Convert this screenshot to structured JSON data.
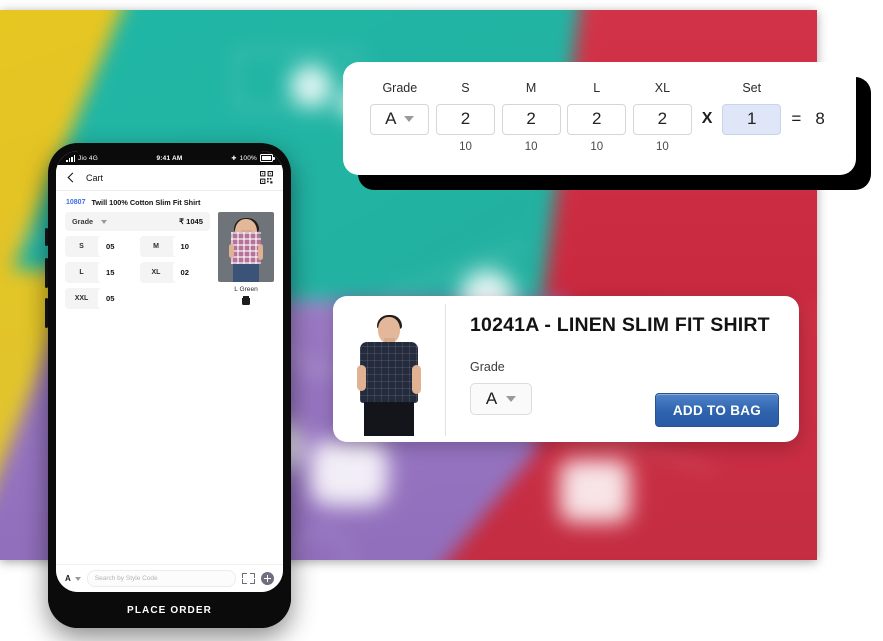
{
  "grade_card": {
    "columns": [
      {
        "label": "Grade",
        "value": "A",
        "sub": "",
        "type": "select"
      },
      {
        "label": "S",
        "value": "2",
        "sub": "10",
        "type": "number"
      },
      {
        "label": "M",
        "value": "2",
        "sub": "10",
        "type": "number"
      },
      {
        "label": "L",
        "value": "2",
        "sub": "10",
        "type": "number"
      },
      {
        "label": "XL",
        "value": "2",
        "sub": "10",
        "type": "number"
      }
    ],
    "multiply_symbol": "X",
    "set": {
      "label": "Set",
      "value": "1"
    },
    "equals_symbol": "=",
    "total": "8",
    "set_highlight_color": "#dee6f7"
  },
  "product_card": {
    "title": "10241A - LINEN SLIM FIT SHIRT",
    "grade_label": "Grade",
    "grade_value": "A",
    "add_to_bag_label": "ADD TO BAG",
    "button_color": "#2f63ae",
    "image_alt": "model-wearing-navy-check-shirt"
  },
  "phone": {
    "status_bar": {
      "carrier": "Jio 4G",
      "time": "9:41 AM",
      "battery": "100%"
    },
    "app_bar": {
      "title": "Cart",
      "back_icon": "back-chevron-icon",
      "scan_icon": "qr-scan-icon"
    },
    "style": {
      "code": "10807",
      "name": "Twill 100% Cotton Slim Fit Shirt",
      "code_color": "#3e6ee0"
    },
    "cart_item": {
      "grade_label": "Grade",
      "price": "₹ 1045",
      "sizes": [
        {
          "size": "S",
          "qty": "05"
        },
        {
          "size": "M",
          "qty": "10"
        },
        {
          "size": "L",
          "qty": "15"
        },
        {
          "size": "XL",
          "qty": "02"
        },
        {
          "size": "XXL",
          "qty": "05"
        }
      ],
      "color_name": "L Green",
      "delete_icon": "trash-icon"
    },
    "bottom_bar": {
      "grade_value": "A",
      "search_placeholder": "Search by Style Code",
      "scan_icon": "scan-frame-icon",
      "add_icon": "plus-circle-icon"
    },
    "place_order_label": "PLACE ORDER"
  },
  "background": {
    "colors": {
      "teal": "#22b3a3",
      "yellow": "#e3c326",
      "red": "#c9293f",
      "purple": "#9b79c4"
    }
  }
}
